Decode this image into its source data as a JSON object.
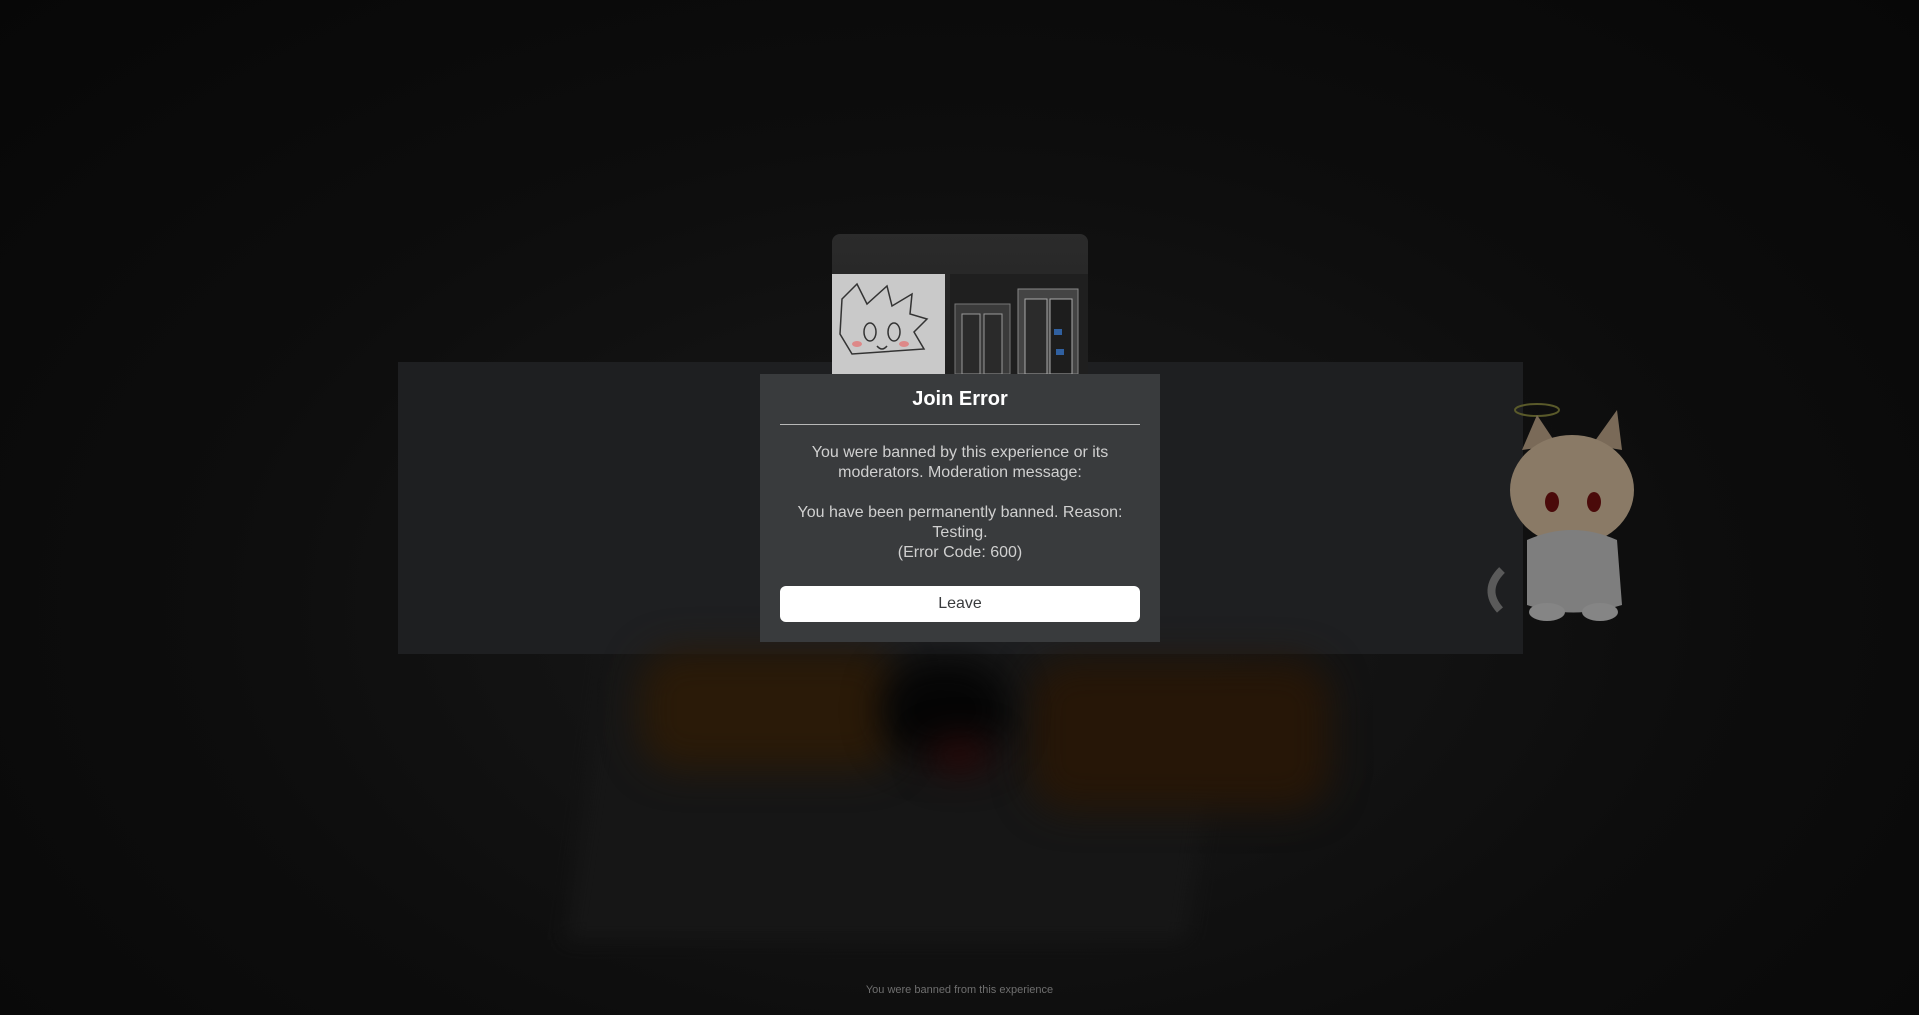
{
  "dialog": {
    "title": "Join Error",
    "message": "You were banned by this experience or its moderators. Moderation message:\n\nYou have been permanently banned. Reason: Testing.\n(Error Code: 600)",
    "leave_label": "Leave"
  },
  "footer": {
    "status": "You were banned from this experience"
  },
  "colors": {
    "dialog_bg": "#393b3d",
    "button_bg": "#ffffff",
    "overlay_bg": "#0b0b0b"
  }
}
